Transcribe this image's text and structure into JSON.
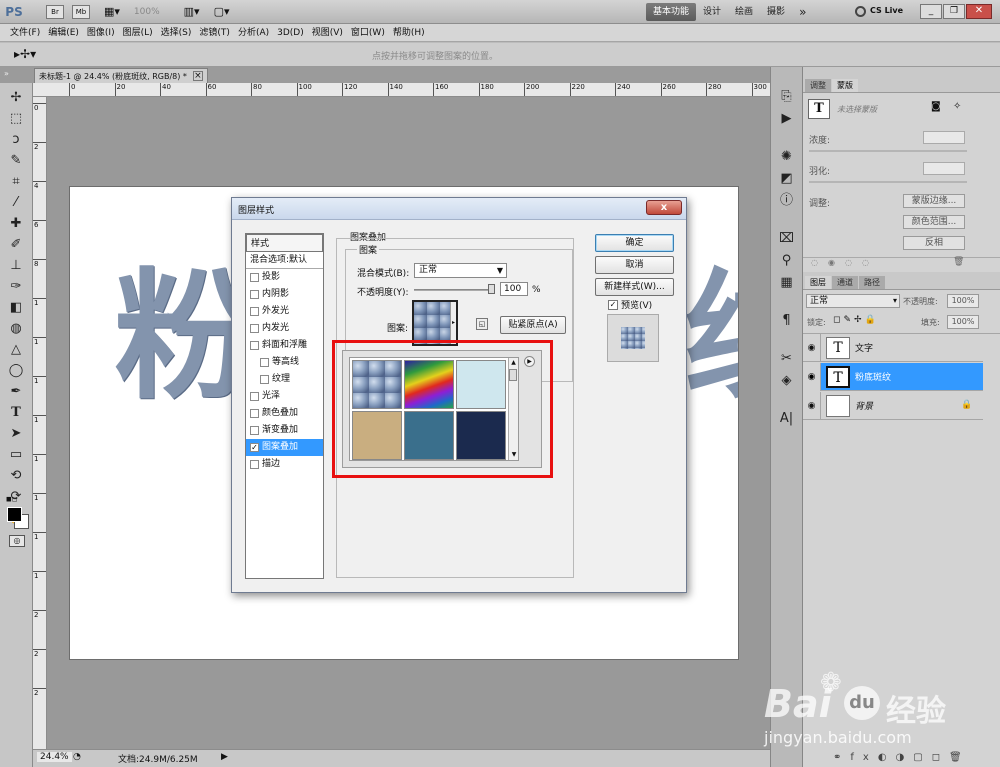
{
  "app": {
    "logo": "PS",
    "zoom": "100%",
    "workspaces": [
      "基本功能",
      "设计",
      "绘画",
      "摄影"
    ],
    "more": "»",
    "cslive": "CS Live"
  },
  "menu": [
    "文件(F)",
    "编辑(E)",
    "图像(I)",
    "图层(L)",
    "选择(S)",
    "滤镜(T)",
    "分析(A)",
    "3D(D)",
    "视图(V)",
    "窗口(W)",
    "帮助(H)"
  ],
  "options": {
    "hint": "点按并拖移可调整图案的位置。"
  },
  "document": {
    "tab": "未标题-1 @ 24.4% (粉底斑纹, RGB/8) *",
    "tab_close": "×",
    "text": "粉",
    "text_right": "纹",
    "ruler": [
      "0",
      "20",
      "40",
      "60",
      "80",
      "100",
      "120",
      "140",
      "160",
      "180",
      "200",
      "220",
      "240",
      "260",
      "280",
      "300"
    ],
    "vruler": [
      "0",
      "2",
      "4",
      "6",
      "8",
      "1",
      "1",
      "1",
      "1",
      "1",
      "1",
      "1",
      "1",
      "2",
      "2",
      "2"
    ]
  },
  "status": {
    "zoom": "24.4%",
    "doc": "文档:24.9M/6.25M"
  },
  "dialog": {
    "title": "图层样式",
    "styles_header": "样式",
    "blend_default": "混合选项:默认",
    "styles": [
      {
        "label": "投影",
        "checked": false,
        "indent": false
      },
      {
        "label": "内阴影",
        "checked": false,
        "indent": false
      },
      {
        "label": "外发光",
        "checked": false,
        "indent": false
      },
      {
        "label": "内发光",
        "checked": false,
        "indent": false
      },
      {
        "label": "斜面和浮雕",
        "checked": false,
        "indent": false
      },
      {
        "label": "等高线",
        "checked": false,
        "indent": true
      },
      {
        "label": "纹理",
        "checked": false,
        "indent": true
      },
      {
        "label": "光泽",
        "checked": false,
        "indent": false
      },
      {
        "label": "颜色叠加",
        "checked": false,
        "indent": false
      },
      {
        "label": "渐变叠加",
        "checked": false,
        "indent": false
      },
      {
        "label": "图案叠加",
        "checked": true,
        "indent": false,
        "selected": true
      },
      {
        "label": "描边",
        "checked": false,
        "indent": false
      }
    ],
    "section_title": "图案叠加",
    "group_title": "图案",
    "blend_label": "混合模式(B):",
    "blend_value": "正常",
    "opacity_label": "不透明度(Y):",
    "opacity_value": "100",
    "opacity_unit": "%",
    "pattern_label": "图案:",
    "snap_btn": "贴紧原点(A)",
    "ok": "确定",
    "cancel": "取消",
    "new_style": "新建样式(W)...",
    "preview": "预览(V)",
    "close": "x"
  },
  "panels": {
    "top_tabs": [
      "调整",
      "蒙版"
    ],
    "mask_hint": "未选择蒙版",
    "density": "浓度:",
    "feather": "羽化:",
    "refine": "调整:",
    "mask_edge": "蒙版边缘...",
    "color_range": "颜色范围...",
    "invert": "反相",
    "layer_tabs": [
      "图层",
      "通道",
      "路径"
    ],
    "blend": "正常",
    "opacity_label": "不透明度:",
    "opacity": "100%",
    "lock": "锁定:",
    "fill_label": "填充:",
    "fill": "100%",
    "layers": [
      {
        "name": "文字",
        "thumb": "T",
        "selected": false
      },
      {
        "name": "粉底斑纹",
        "thumb": "T",
        "selected": true
      },
      {
        "name": "背景",
        "thumb": "",
        "selected": false,
        "locked": true
      }
    ]
  },
  "watermark": {
    "brand": "Bai",
    "suffix": "经验",
    "url": "jingyan.baidu.com"
  },
  "colors": {
    "accent": "#3399ff",
    "highlight": "#e81010",
    "dialog_bg": "#f0f0f0"
  }
}
